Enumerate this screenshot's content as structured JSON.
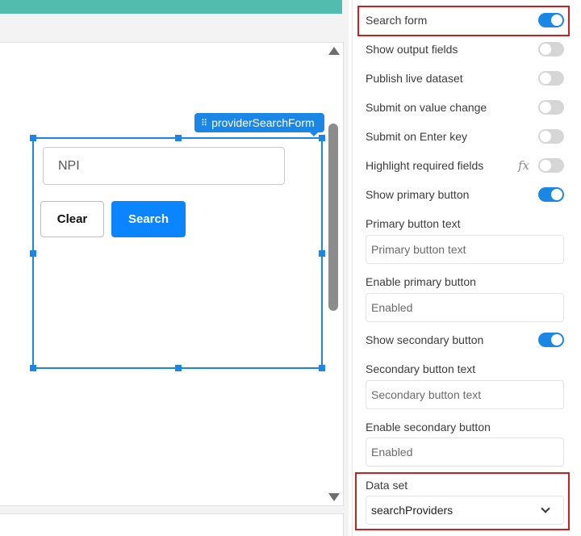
{
  "canvas": {
    "component_label": "providerSearchForm",
    "npi_input": {
      "placeholder": "NPI"
    },
    "clear_button": "Clear",
    "search_button": "Search"
  },
  "properties": {
    "search_form": {
      "label": "Search form",
      "on": true
    },
    "show_output_fields": {
      "label": "Show output fields",
      "on": false
    },
    "publish_live_dataset": {
      "label": "Publish live dataset",
      "on": false
    },
    "submit_on_value_change": {
      "label": "Submit on value change",
      "on": false
    },
    "submit_on_enter_key": {
      "label": "Submit on Enter key",
      "on": false
    },
    "highlight_required_fields": {
      "label": "Highlight required fields",
      "on": false,
      "fx_icon": "fx-icon"
    },
    "show_primary_button": {
      "label": "Show primary button",
      "on": true
    },
    "primary_button_text": {
      "label": "Primary button text",
      "placeholder": "Primary button text"
    },
    "enable_primary_button": {
      "label": "Enable primary button",
      "placeholder": "Enabled"
    },
    "show_secondary_button": {
      "label": "Show secondary button",
      "on": true
    },
    "secondary_button_text": {
      "label": "Secondary button text",
      "placeholder": "Secondary button text"
    },
    "enable_secondary_button": {
      "label": "Enable secondary button",
      "placeholder": "Enabled"
    },
    "data_set": {
      "label": "Data set",
      "value": "searchProviders"
    }
  },
  "colors": {
    "accent": "#1a87e6",
    "search_button": "#0a84ff",
    "top_bar": "#52bcaf",
    "highlight": "#cc1f1f"
  }
}
